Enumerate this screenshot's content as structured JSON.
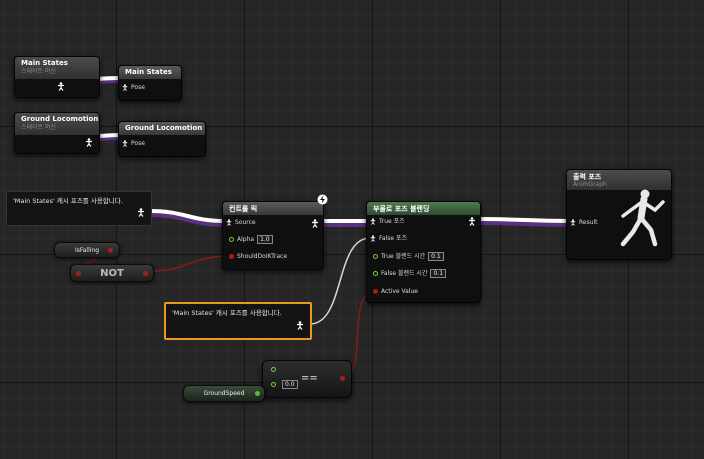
{
  "colors": {
    "pose_wire": "#ffffff",
    "pose_wire_shadow": "#6a3a8a",
    "bool_wire": "#8a1a1a",
    "float_wire": "#6fcf3a",
    "blend_header": "#4f7a50"
  },
  "nodes": {
    "main_states_sm": {
      "title": "Main States",
      "subtitle": "스테이트 머신"
    },
    "main_states_save": {
      "title": "Main States",
      "pin_pose": "Pose"
    },
    "ground_locomotion_sm": {
      "title": "Ground Locomotion",
      "subtitle": "스테이트 머신"
    },
    "ground_locomotion_save": {
      "title": "Ground Locomotion",
      "pin_pose": "Pose"
    },
    "control_rig": {
      "title": "컨트롤 릭",
      "pin_source": "Source",
      "pin_alpha": "Alpha",
      "alpha_value": "1.0",
      "pin_should_do_ik": "ShouldDoIKTrace"
    },
    "blend_poses_by_bool": {
      "title": "부울로 포즈 블렌딩",
      "pin_true_pose": "True 포즈",
      "pin_false_pose": "False 포즈",
      "pin_true_blend_time": "True 블렌드 시간",
      "true_blend_time_value": "0.1",
      "pin_false_blend_time": "False 블렌드 시간",
      "false_blend_time_value": "0.1",
      "pin_active_value": "Active Value"
    },
    "output_pose": {
      "title": "출력 포즈",
      "subtitle": "AnimGraph",
      "pin_result": "Result"
    },
    "use_cached_main_1": {
      "label": "'Main States' 캐시 포즈를 사용합니다."
    },
    "use_cached_main_2": {
      "label": "'Main States' 캐시 포즈를 사용합니다."
    },
    "is_falling": {
      "label": "IsFalling"
    },
    "not_node": {
      "label": "NOT"
    },
    "equal_node": {
      "label": "==",
      "value": "0.0"
    },
    "ground_speed": {
      "label": "GroundSpeed"
    }
  },
  "icons": [
    "pose-icon",
    "mannequin-icon",
    "lightning-icon"
  ]
}
